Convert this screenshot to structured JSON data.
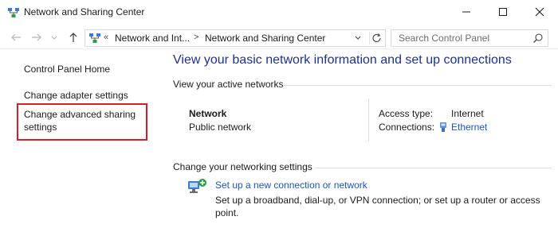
{
  "window": {
    "title": "Network and Sharing Center",
    "icon": "network-sharing-icon"
  },
  "address": {
    "crumb_prefix": "«",
    "crumb1": "Network and Int...",
    "separator": ">",
    "crumb2": "Network and Sharing Center"
  },
  "search": {
    "placeholder": "Search Control Panel"
  },
  "sidebar": {
    "items": [
      {
        "label": "Control Panel Home"
      },
      {
        "label": "Change adapter settings"
      },
      {
        "label": "Change advanced sharing settings"
      }
    ]
  },
  "main": {
    "title": "View your basic network information and set up connections",
    "active_networks_label": "View your active networks",
    "network": {
      "name": "Network",
      "type": "Public network",
      "access_type_label": "Access type:",
      "access_type_value": "Internet",
      "connections_label": "Connections:",
      "connections_value": "Ethernet"
    },
    "change_settings_label": "Change your networking settings",
    "tasks": [
      {
        "link": "Set up a new connection or network",
        "description": "Set up a broadband, dial-up, or VPN connection; or set up a router or access point."
      }
    ]
  },
  "colors": {
    "title_blue": "#1e3287",
    "link_blue": "#1e54b8",
    "highlight_red": "#d31f26"
  }
}
